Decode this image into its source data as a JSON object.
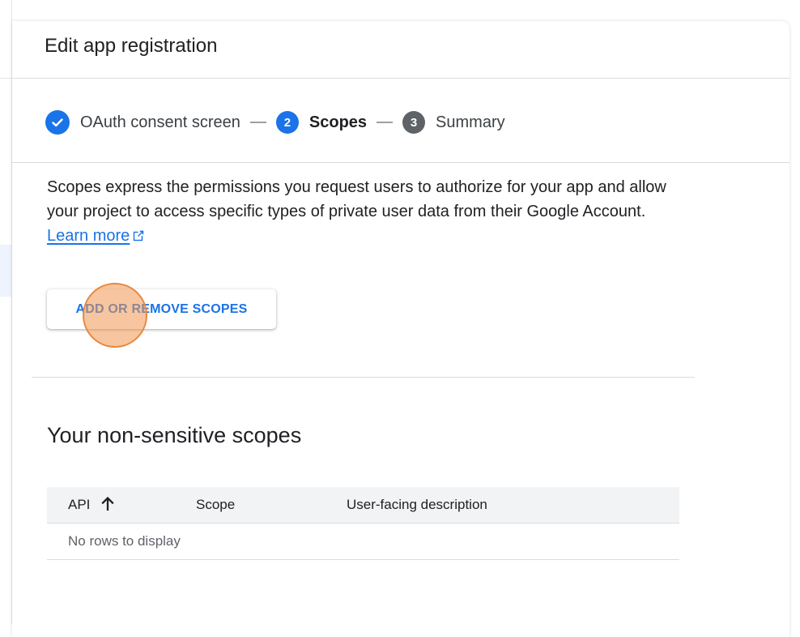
{
  "page": {
    "title": "Edit app registration"
  },
  "stepper": {
    "steps": [
      {
        "label": "OAuth consent screen",
        "status": "complete",
        "icon": "check-icon"
      },
      {
        "number": "2",
        "label": "Scopes",
        "status": "active"
      },
      {
        "number": "3",
        "label": "Summary",
        "status": "upcoming"
      }
    ]
  },
  "description": {
    "text": "Scopes express the permissions you request users to authorize for your app and allow your project to access specific types of private user data from their Google Account.",
    "link_label": "Learn more",
    "link_icon": "external-link-icon"
  },
  "actions": {
    "add_remove_label": "ADD OR REMOVE SCOPES"
  },
  "non_sensitive": {
    "title": "Your non-sensitive scopes",
    "columns": [
      "API",
      "Scope",
      "User-facing description"
    ],
    "sort_icon": "arrow-up-icon",
    "empty_text": "No rows to display"
  },
  "colors": {
    "accent": "#1a73e8",
    "inactive_step": "#5f6368",
    "click_marker": "#e8883c"
  }
}
